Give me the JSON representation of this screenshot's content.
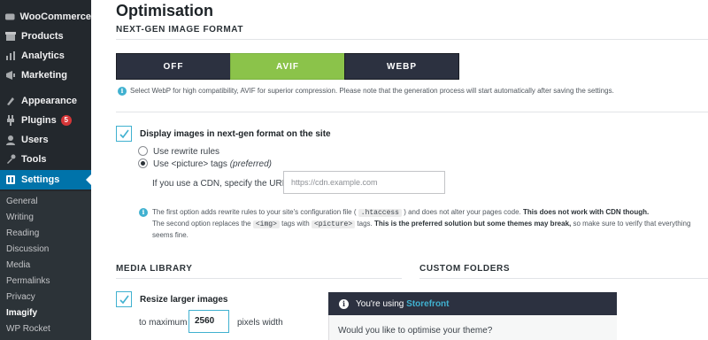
{
  "sidebar": {
    "items": [
      {
        "label": "WooCommerce",
        "icon": "woocommerce-icon"
      },
      {
        "label": "Products",
        "icon": "products-icon"
      },
      {
        "label": "Analytics",
        "icon": "analytics-icon"
      },
      {
        "label": "Marketing",
        "icon": "marketing-icon"
      },
      {
        "label": "Appearance",
        "icon": "appearance-icon"
      },
      {
        "label": "Plugins",
        "icon": "plugins-icon",
        "badge": "5"
      },
      {
        "label": "Users",
        "icon": "users-icon"
      },
      {
        "label": "Tools",
        "icon": "tools-icon"
      },
      {
        "label": "Settings",
        "icon": "settings-icon",
        "active": true
      }
    ],
    "submenu": [
      "General",
      "Writing",
      "Reading",
      "Discussion",
      "Media",
      "Permalinks",
      "Privacy",
      "Imagify",
      "WP Rocket"
    ],
    "submenu_current": "Imagify"
  },
  "main": {
    "title": "Optimisation",
    "nextgen": {
      "section_title": "NEXT-GEN IMAGE FORMAT",
      "options": [
        "OFF",
        "AVIF",
        "WEBP"
      ],
      "selected": "AVIF",
      "hint": "Select WebP for high compatibility, AVIF for superior compression. Please note that the generation process will start automatically after saving the settings."
    },
    "display": {
      "label": "Display images in next-gen format on the site",
      "checked": true,
      "radio1": "Use rewrite rules",
      "radio2_main": "Use <picture> tags",
      "radio2_pref": "(preferred)",
      "selected_radio": 2,
      "cdn_label": "If you use a CDN, specify the URL:",
      "cdn_placeholder": "https://cdn.example.com",
      "note1_a": "The first option adds rewrite rules to your site's configuration file (",
      "note1_code": ".htaccess",
      "note1_b": ") and does not alter your pages code.",
      "note1_bold": "This does not work with CDN though.",
      "note2_a": "The second option replaces the",
      "note2_code1": "<img>",
      "note2_mid": "tags with",
      "note2_code2": "<picture>",
      "note2_b": "tags.",
      "note2_bold": "This is the preferred solution but some themes may break,",
      "note2_c": "so make sure to verify that everything",
      "note3": "seems fine."
    },
    "media_library": {
      "section_title": "MEDIA LIBRARY",
      "resize_label": "Resize larger images",
      "resize_checked": true,
      "max_prefix": "to maximum",
      "max_value": "2560",
      "max_suffix": "pixels width"
    },
    "custom_folders": {
      "section_title": "CUSTOM FOLDERS",
      "notice_prefix": "You're using",
      "notice_theme": "Storefront",
      "question": "Would you like to optimise your theme?"
    }
  },
  "colors": {
    "sidebar_bg": "#23282d",
    "active": "#0073aa",
    "avif_green": "#8bc34a",
    "info_blue": "#40b1d0",
    "dark_button": "#2c3140"
  }
}
